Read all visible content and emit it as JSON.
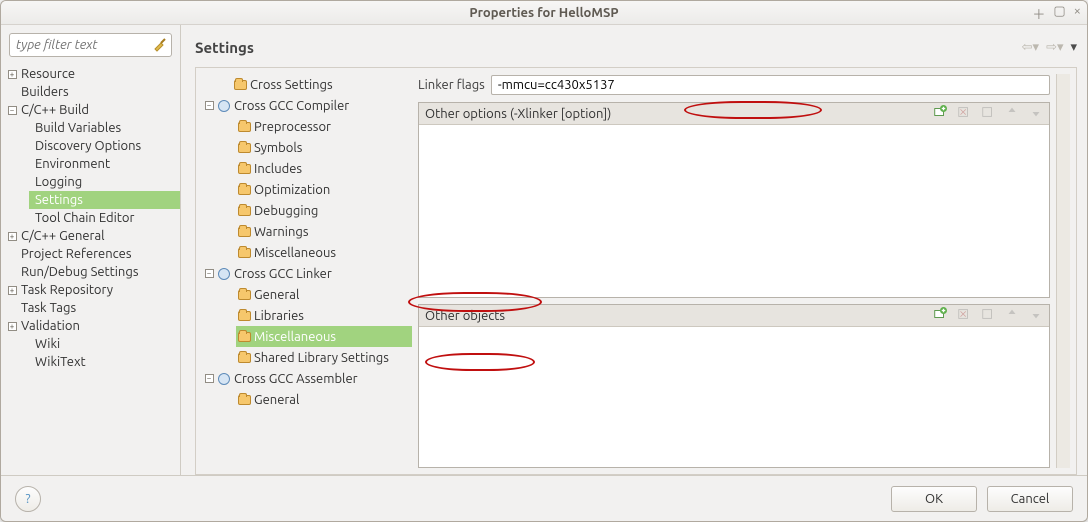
{
  "window": {
    "title": "Properties for HelloMSP"
  },
  "left": {
    "filter_placeholder": "type filter text",
    "items": [
      "Resource",
      "Builders",
      "C/C++ Build",
      "C/C++ General",
      "Project References",
      "Run/Debug Settings",
      "Task Repository",
      "Task Tags",
      "Validation",
      "Wiki",
      "WikiText"
    ],
    "cbuild": [
      "Build Variables",
      "Discovery Options",
      "Environment",
      "Logging",
      "Settings",
      "Tool Chain Editor"
    ]
  },
  "header": {
    "title": "Settings"
  },
  "mid": [
    {
      "label": "Cross Settings"
    },
    {
      "label": "Cross GCC Compiler",
      "children": [
        "Preprocessor",
        "Symbols",
        "Includes",
        "Optimization",
        "Debugging",
        "Warnings",
        "Miscellaneous"
      ]
    },
    {
      "label": "Cross GCC Linker",
      "children": [
        "General",
        "Libraries",
        "Miscellaneous",
        "Shared Library Settings"
      ]
    },
    {
      "label": "Cross GCC Assembler",
      "children": [
        "General"
      ]
    }
  ],
  "detail": {
    "linker_flags_label": "Linker flags",
    "linker_flags_value": "-mmcu=cc430x5137",
    "other_options_label": "Other options (-Xlinker [option])",
    "other_objects_label": "Other objects"
  },
  "footer": {
    "ok": "OK",
    "cancel": "Cancel"
  }
}
